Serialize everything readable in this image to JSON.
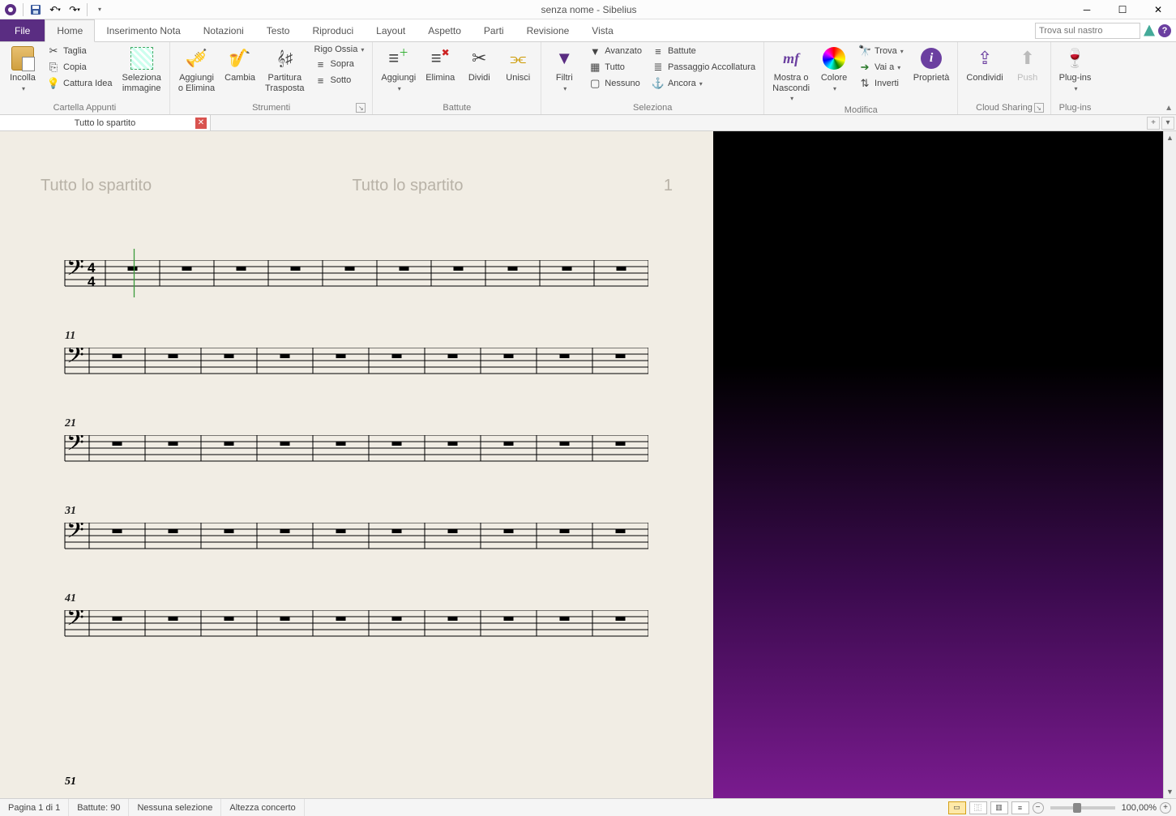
{
  "title": "senza nome - Sibelius",
  "ribbon_search_placeholder": "Trova sul nastro",
  "tabs": {
    "file": "File",
    "items": [
      "Home",
      "Inserimento Nota",
      "Notazioni",
      "Testo",
      "Riproduci",
      "Layout",
      "Aspetto",
      "Parti",
      "Revisione",
      "Vista"
    ],
    "active": "Home"
  },
  "ribbon": {
    "groups": {
      "clipboard": {
        "label": "Cartella Appunti",
        "paste": "Incolla",
        "cut": "Taglia",
        "copy": "Copia",
        "capture": "Cattura Idea",
        "select_img": "Seleziona\nimmagine"
      },
      "instruments": {
        "label": "Strumenti",
        "add_remove": "Aggiungi\no Elimina",
        "change": "Cambia",
        "transposing": "Partitura\nTrasposta",
        "ossia": "Rigo Ossia",
        "above": "Sopra",
        "below": "Sotto"
      },
      "bars": {
        "label": "Battute",
        "add": "Aggiungi",
        "delete": "Elimina",
        "split": "Dividi",
        "join": "Unisci"
      },
      "selection": {
        "label": "Seleziona",
        "filters": "Filtri",
        "advanced": "Avanzato",
        "all": "Tutto",
        "none": "Nessuno",
        "bars_btn": "Battute",
        "system_passage": "Passaggio Accollatura",
        "more": "Ancora"
      },
      "edit": {
        "label": "Modifica",
        "hide_show": "Mostra o\nNascondi",
        "color": "Colore",
        "find": "Trova",
        "goto": "Vai a",
        "flip": "Inverti",
        "properties": "Proprietà"
      },
      "cloud": {
        "label": "Cloud Sharing",
        "share": "Condividi",
        "push": "Push"
      },
      "plugins": {
        "label": "Plug-ins",
        "plugins": "Plug-ins"
      }
    }
  },
  "doc_tab": "Tutto lo spartito",
  "score": {
    "running_head_left": "Tutto lo spartito",
    "running_head_center": "Tutto lo spartito",
    "page_num": "1",
    "time_sig": "4/4",
    "systems": [
      {
        "bar_number": "",
        "bars": 10,
        "show_timesig": true
      },
      {
        "bar_number": "11",
        "bars": 10
      },
      {
        "bar_number": "21",
        "bars": 10
      },
      {
        "bar_number": "31",
        "bars": 10
      },
      {
        "bar_number": "41",
        "bars": 10
      }
    ],
    "partial_label": "51"
  },
  "status": {
    "page": "Pagina 1 di 1",
    "bars": "Battute: 90",
    "selection": "Nessuna selezione",
    "pitch": "Altezza concerto",
    "zoom": "100,00%"
  }
}
